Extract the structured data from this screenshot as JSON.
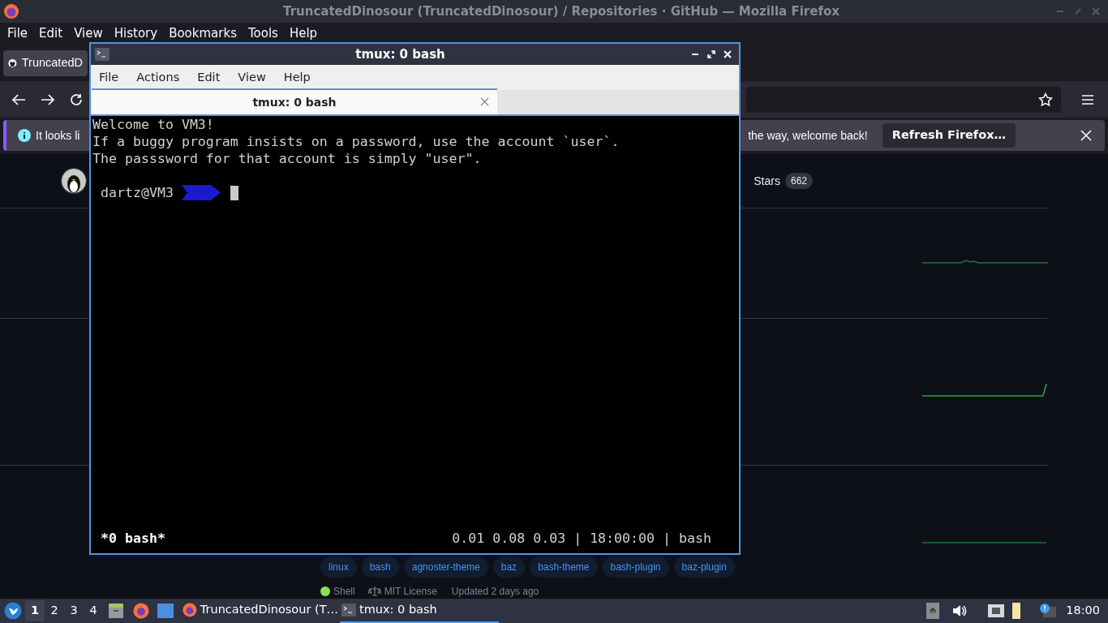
{
  "firefox": {
    "title": "TruncatedDinosour (TruncatedDinosour) / Repositories · GitHub — Mozilla Firefox",
    "menu": [
      "File",
      "Edit",
      "View",
      "History",
      "Bookmarks",
      "Tools",
      "Help"
    ],
    "tab": {
      "title": "TruncatedD"
    },
    "notification": {
      "text_start": "It looks li",
      "text_end": "the way, welcome back!",
      "button": "Refresh Firefox…"
    },
    "github": {
      "stars_label": "Stars",
      "stars_count": "662",
      "topics": [
        "linux",
        "bash",
        "agnoster-theme",
        "baz",
        "bash-theme",
        "bash-plugin",
        "baz-plugin"
      ],
      "meta": {
        "language": "Shell",
        "license": "MIT License",
        "updated": "Updated 2 days ago"
      }
    }
  },
  "terminal": {
    "title": "tmux: 0 bash",
    "menu": [
      "File",
      "Actions",
      "Edit",
      "View",
      "Help"
    ],
    "tab": {
      "title": "tmux: 0 bash"
    },
    "lines": [
      "Welcome to VM3!",
      "If a buggy program insists on a password, use the account `user`.",
      "The passsword for that account is simply \"user\"."
    ],
    "prompt": {
      "user_host": "dartz@VM3",
      "path": "~"
    },
    "status": {
      "left": "*0 bash*",
      "right": "0.01 0.08 0.03 | 18:00:00 | bash"
    }
  },
  "taskbar": {
    "workspaces": [
      {
        "label": "1",
        "selected": true
      },
      {
        "label": "2",
        "selected": false
      },
      {
        "label": "3",
        "selected": false
      },
      {
        "label": "4",
        "selected": false
      }
    ],
    "tasks": [
      {
        "kind": "browser",
        "label": "TruncatedDinosour (T…",
        "selected": false
      },
      {
        "kind": "terminal",
        "label": "tmux: 0 bash",
        "selected": true
      }
    ],
    "clock": "18:00"
  }
}
